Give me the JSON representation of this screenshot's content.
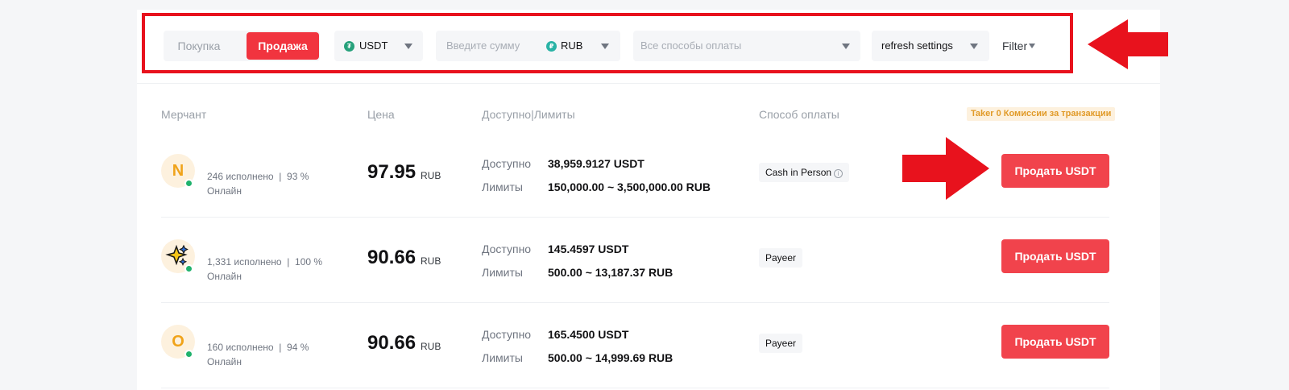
{
  "filters": {
    "tab_buy": "Покупка",
    "tab_sell": "Продажа",
    "asset": "USDT",
    "amount_placeholder": "Введите сумму",
    "fiat": "RUB",
    "payment_placeholder": "Все способы оплаты",
    "refresh": "refresh settings",
    "filter": "Filter"
  },
  "table": {
    "headers": {
      "merchant": "Мерчант",
      "price": "Цена",
      "available_limits": "Доступно|Лимиты",
      "payment": "Способ оплаты"
    },
    "taker_badge": "Taker 0 Комиссии за транзакции",
    "available_label": "Доступно",
    "limits_label": "Лимиты",
    "rows": [
      {
        "avatar": "N",
        "stats": "246 исполнено  |  93 %",
        "status": "Онлайн",
        "price": "97.95",
        "currency": "RUB",
        "available": "38,959.9127 USDT",
        "limits": "150,000.00 ~ 3,500,000.00 RUB",
        "payment": "Cash in Person",
        "action": "Продать USDT"
      },
      {
        "avatar": "sparkle-avatar",
        "stats": "1,331 исполнено  |  100 %",
        "status": "Онлайн",
        "price": "90.66",
        "currency": "RUB",
        "available": "145.4597 USDT",
        "limits": "500.00 ~ 13,187.37 RUB",
        "payment": "Payeer",
        "action": "Продать USDT"
      },
      {
        "avatar": "O",
        "stats": "160 исполнено  |  94 %",
        "status": "Онлайн",
        "price": "90.66",
        "currency": "RUB",
        "available": "165.4500 USDT",
        "limits": "500.00 ~ 14,999.69 RUB",
        "payment": "Payeer",
        "action": "Продать USDT"
      }
    ]
  },
  "colors": {
    "accent": "#f1343f",
    "annotation": "#e8121d",
    "online": "#20b26c",
    "usdt": "#26a17b",
    "rub": "#2ab3a6"
  }
}
